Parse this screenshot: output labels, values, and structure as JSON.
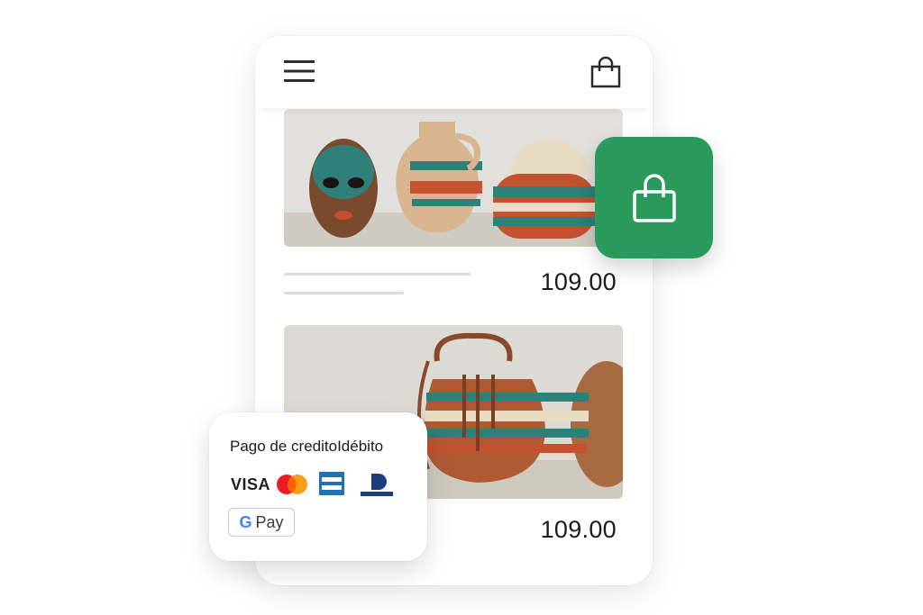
{
  "header": {
    "menu_icon": "hamburger-menu-icon",
    "cart_icon": "shopping-bag-icon"
  },
  "products": [
    {
      "price": "109.00",
      "image": "masks-vase-hat"
    },
    {
      "price": "109.00",
      "image": "woven-bag"
    }
  ],
  "fab": {
    "icon": "shopping-bag-icon",
    "color": "#2a9a5c"
  },
  "payment": {
    "title": "Pago de creditoIdébito",
    "cards": [
      "VISA",
      "mastercard",
      "amex",
      "diners"
    ],
    "visa_label": "VISA",
    "wallet_g": "G",
    "wallet_label": "Pay"
  }
}
